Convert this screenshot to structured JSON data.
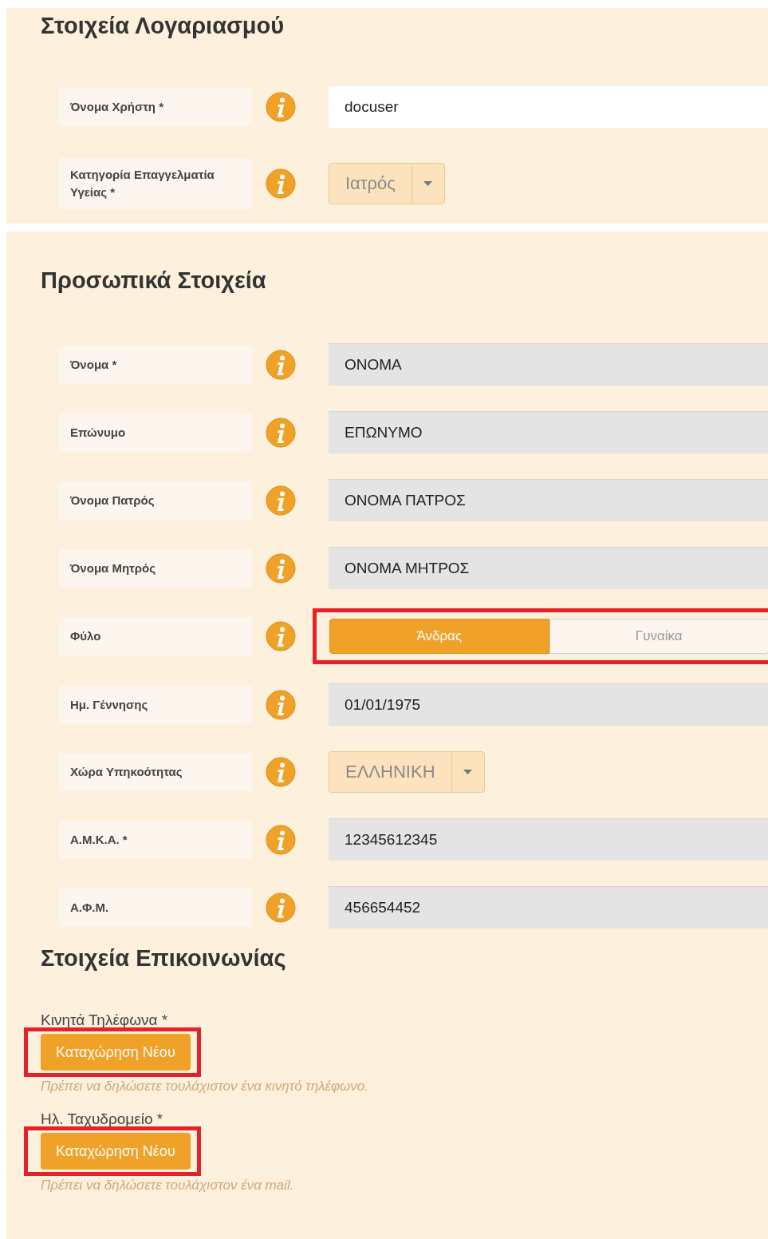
{
  "account": {
    "title": "Στοιχεία Λογαριασμού",
    "fields": [
      {
        "kind": "input",
        "label": "Όνομα Χρήστη *",
        "value": "docuser"
      },
      {
        "kind": "select",
        "label": "Κατηγορία Επαγγελματία Υγείας *",
        "value": "Ιατρός"
      }
    ]
  },
  "personal": {
    "title": "Προσωπικά Στοιχεία",
    "fields": [
      {
        "kind": "readonly",
        "label": "Όνομα *",
        "value": "ΟΝΟΜΑ"
      },
      {
        "kind": "readonly",
        "label": "Επώνυμο",
        "value": "ΕΠΩΝΥΜΟ"
      },
      {
        "kind": "readonly",
        "label": "Όνομα Πατρός",
        "value": "ΟΝΟΜΑ ΠΑΤΡΟΣ"
      },
      {
        "kind": "readonly",
        "label": "Όνομα Μητρός",
        "value": "ΟΝΟΜΑ ΜΗΤΡΟΣ"
      },
      {
        "kind": "toggle",
        "label": "Φύλο",
        "highlighted": true,
        "options": [
          {
            "label": "Άνδρας",
            "selected": true
          },
          {
            "label": "Γυναίκα",
            "selected": false
          }
        ]
      },
      {
        "kind": "readonly",
        "label": "Ημ. Γέννησης",
        "value": "01/01/1975"
      },
      {
        "kind": "select",
        "label": "Χώρα Υπηκοότητας",
        "value": "ΕΛΛΗΝΙΚΗ"
      },
      {
        "kind": "readonly",
        "label": "Α.Μ.Κ.Α. *",
        "value": "12345612345"
      },
      {
        "kind": "readonly",
        "label": "Α.Φ.Μ.",
        "value": "456654452"
      }
    ]
  },
  "contact": {
    "title": "Στοιχεία Επικοινωνίας",
    "groups": [
      {
        "label": "Κινητά Τηλέφωνα *",
        "button": {
          "label": "Καταχώρηση Νέου",
          "highlighted": true
        },
        "hint": "Πρέπει να δηλώσετε τουλάχιστον ένα κινητό τηλέφωνο."
      },
      {
        "label": "Ηλ. Ταχυδρομείο *",
        "button": {
          "label": "Καταχώρηση Νέου",
          "highlighted": true
        },
        "hint": "Πρέπει να δηλώσετε τουλάχιστον ένα mail."
      }
    ]
  }
}
